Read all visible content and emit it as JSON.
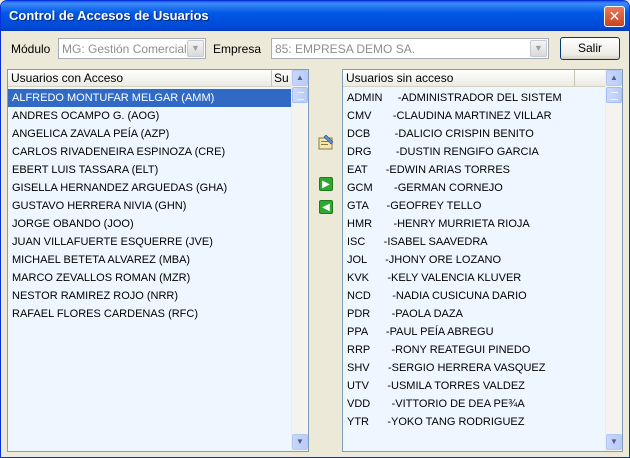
{
  "window": {
    "title": "Control de Accesos de Usuarios",
    "close_glyph": "✕"
  },
  "filters": {
    "modulo_label": "Módulo",
    "modulo_value": "MG: Gestión Comercial",
    "empresa_label": "Empresa",
    "empresa_value": "85: EMPRESA DEMO SA.",
    "salir_label": "Salir"
  },
  "left_panel": {
    "col1": "Usuarios con Acceso",
    "col2": "Su",
    "rows": [
      "ALFREDO MONTUFAR MELGAR (AMM)",
      "ANDRES OCAMPO G. (AOG)",
      "ANGELICA ZAVALA PEÍA (AZP)",
      "CARLOS RIVADENEIRA ESPINOZA (CRE)",
      "EBERT LUIS TASSARA (ELT)",
      "GISELLA HERNANDEZ ARGUEDAS (GHA)",
      "GUSTAVO HERRERA NIVIA (GHN)",
      "JORGE OBANDO (JOO)",
      "JUAN VILLAFUERTE ESQUERRE (JVE)",
      "MICHAEL BETETA ALVAREZ (MBA)",
      "MARCO ZEVALLOS ROMAN (MZR)",
      "NESTOR RAMIREZ ROJO (NRR)",
      "RAFAEL FLORES CARDENAS (RFC)"
    ],
    "selected_row": "ALFREDO MONTUFAR MELGAR (AMM)"
  },
  "right_panel": {
    "col1": "Usuarios sin acceso",
    "rows": [
      "ADMIN     -ADMINISTRADOR DEL SISTEM",
      "CMV       -CLAUDINA MARTINEZ VILLAR",
      "DCB        -DALICIO CRISPIN BENITO",
      "DRG        -DUSTIN RENGIFO GARCIA",
      "EAT      -EDWIN ARIAS TORRES",
      "GCM       -GERMAN CORNEJO",
      "GTA      -GEOFREY TELLO",
      "HMR       -HENRY MURRIETA RIOJA",
      "ISC      -ISABEL SAAVEDRA",
      "JOL      -JHONY ORE LOZANO",
      "KVK      -KELY VALENCIA KLUVER",
      "NCD       -NADIA CUSICUNA DARIO",
      "PDR       -PAOLA DAZA",
      "PPA      -PAUL PEÍA ABREGU",
      "RRP       -RONY REATEGUI PINEDO",
      "SHV      -SERGIO HERRERA VASQUEZ",
      "UTV      -USMILA TORRES VALDEZ",
      "VDD       -VITTORIO DE DEA PE¾A",
      "YTR      -YOKO TANG RODRIGUEZ"
    ]
  },
  "colors": {
    "selection": "#316ac5",
    "list_bg": "#eef7ff",
    "titlebar": "#0058e6"
  },
  "icons": {
    "close": "close-icon",
    "edit": "edit-properties-icon",
    "add": "arrow-right-icon",
    "remove": "arrow-left-icon"
  }
}
